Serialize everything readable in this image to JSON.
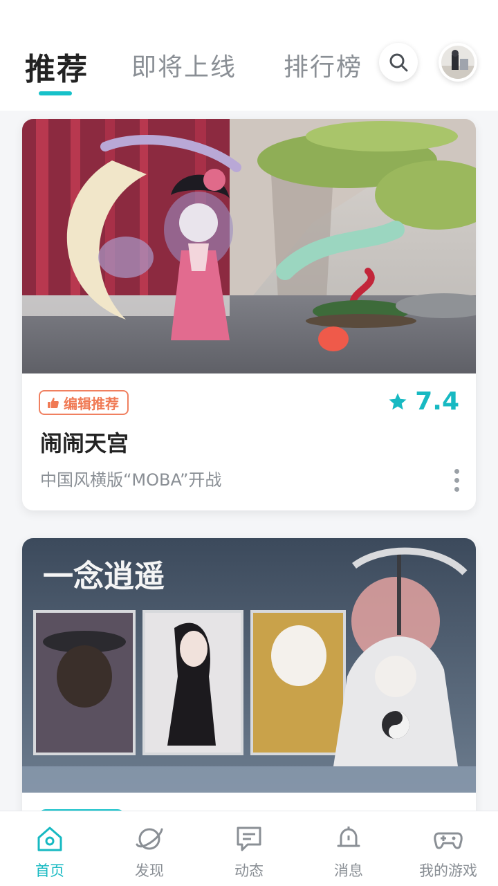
{
  "tabs": [
    {
      "label": "推荐",
      "active": true
    },
    {
      "label": "即将上线",
      "active": false
    },
    {
      "label": "排行榜",
      "active": false
    }
  ],
  "header": {
    "search_icon": "search-icon",
    "avatar": "avatar"
  },
  "cards": [
    {
      "badge": "编辑推荐",
      "rating": "7.4",
      "title": "闹闹天宫",
      "description": "中国风横版“MOBA”开战"
    },
    {
      "art_title": "一念逍遥"
    }
  ],
  "bottom_nav": [
    {
      "label": "首页",
      "icon": "home-icon",
      "active": true
    },
    {
      "label": "发现",
      "icon": "planet-icon",
      "active": false
    },
    {
      "label": "动态",
      "icon": "message-icon",
      "active": false
    },
    {
      "label": "消息",
      "icon": "bell-icon",
      "active": false
    },
    {
      "label": "我的游戏",
      "icon": "gamepad-icon",
      "active": false
    }
  ],
  "colors": {
    "accent": "#17c1c9",
    "badge": "#f07a55",
    "text_muted": "#8a8f95"
  }
}
